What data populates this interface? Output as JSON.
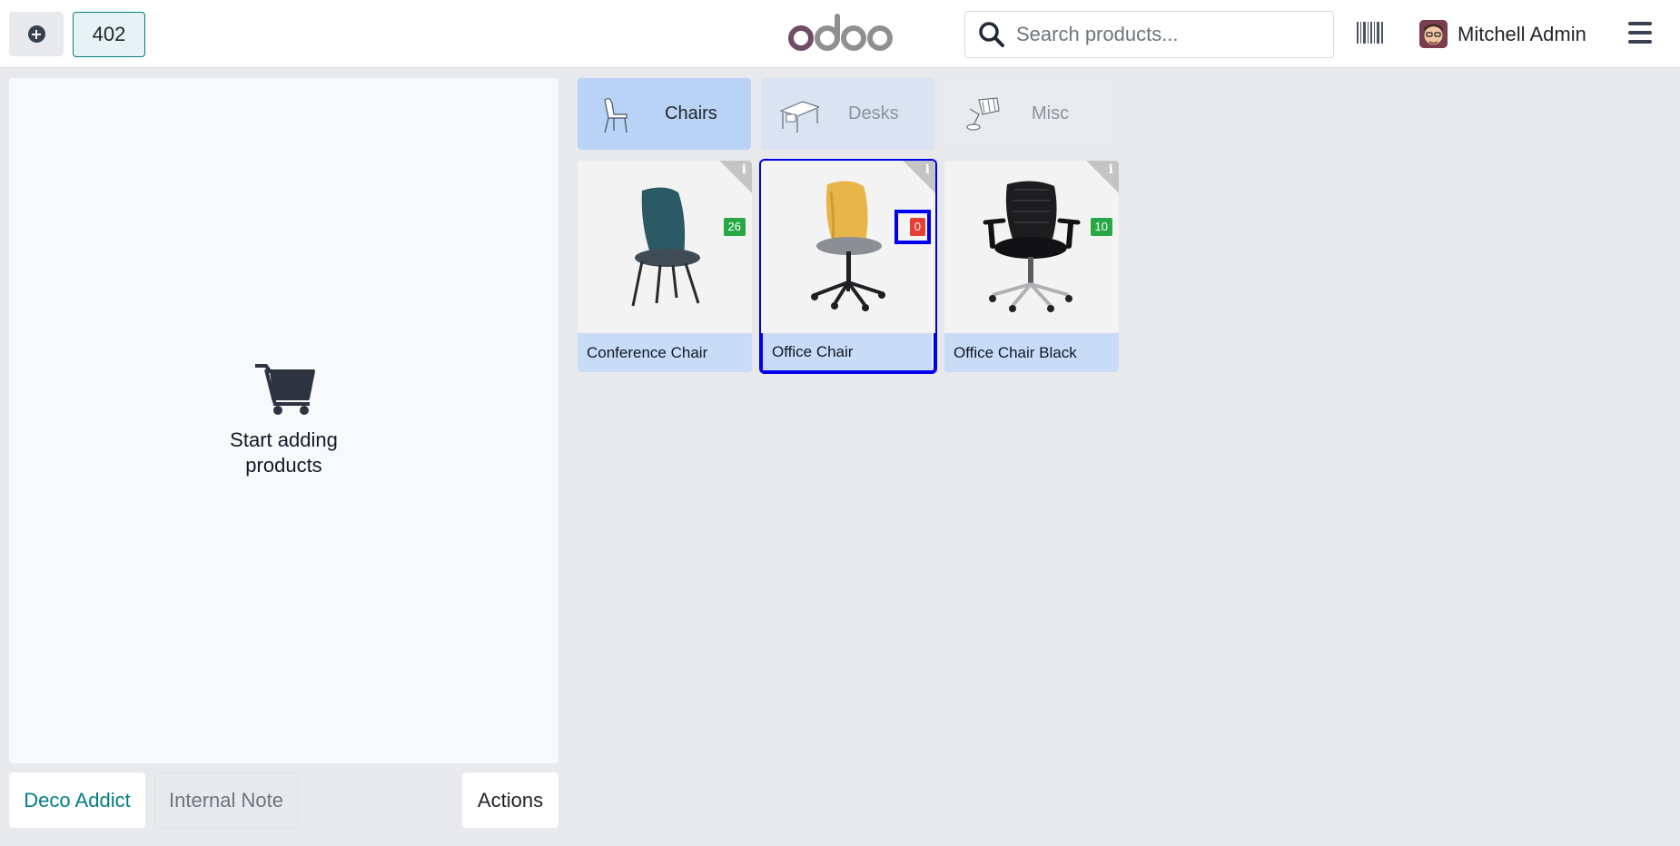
{
  "topbar": {
    "order_number": "402",
    "logo_text": "odoo",
    "search_placeholder": "Search products...",
    "user_name": "Mitchell Admin"
  },
  "cart": {
    "empty_line1": "Start adding",
    "empty_line2": "products"
  },
  "footer": {
    "customer_label": "Deco Addict",
    "note_label": "Internal Note",
    "actions_label": "Actions"
  },
  "categories": [
    {
      "label": "Chairs",
      "icon": "chair-icon",
      "active": true
    },
    {
      "label": "Desks",
      "icon": "desk-icon",
      "active": false
    },
    {
      "label": "Misc",
      "icon": "lamp-icon",
      "active": false
    }
  ],
  "products": [
    {
      "name": "Conference Chair",
      "qty": "26",
      "status_color": "#28a745"
    },
    {
      "name": "Office Chair",
      "qty": "0",
      "status_color": "#e54033"
    },
    {
      "name": "Office Chair Black",
      "qty": "10",
      "status_color": "#28a745"
    }
  ],
  "colors": {
    "accent": "#017e84",
    "category_active": "#b8d3f5",
    "product_label_bg": "#c8dcf7",
    "highlight": "#0000ee"
  }
}
